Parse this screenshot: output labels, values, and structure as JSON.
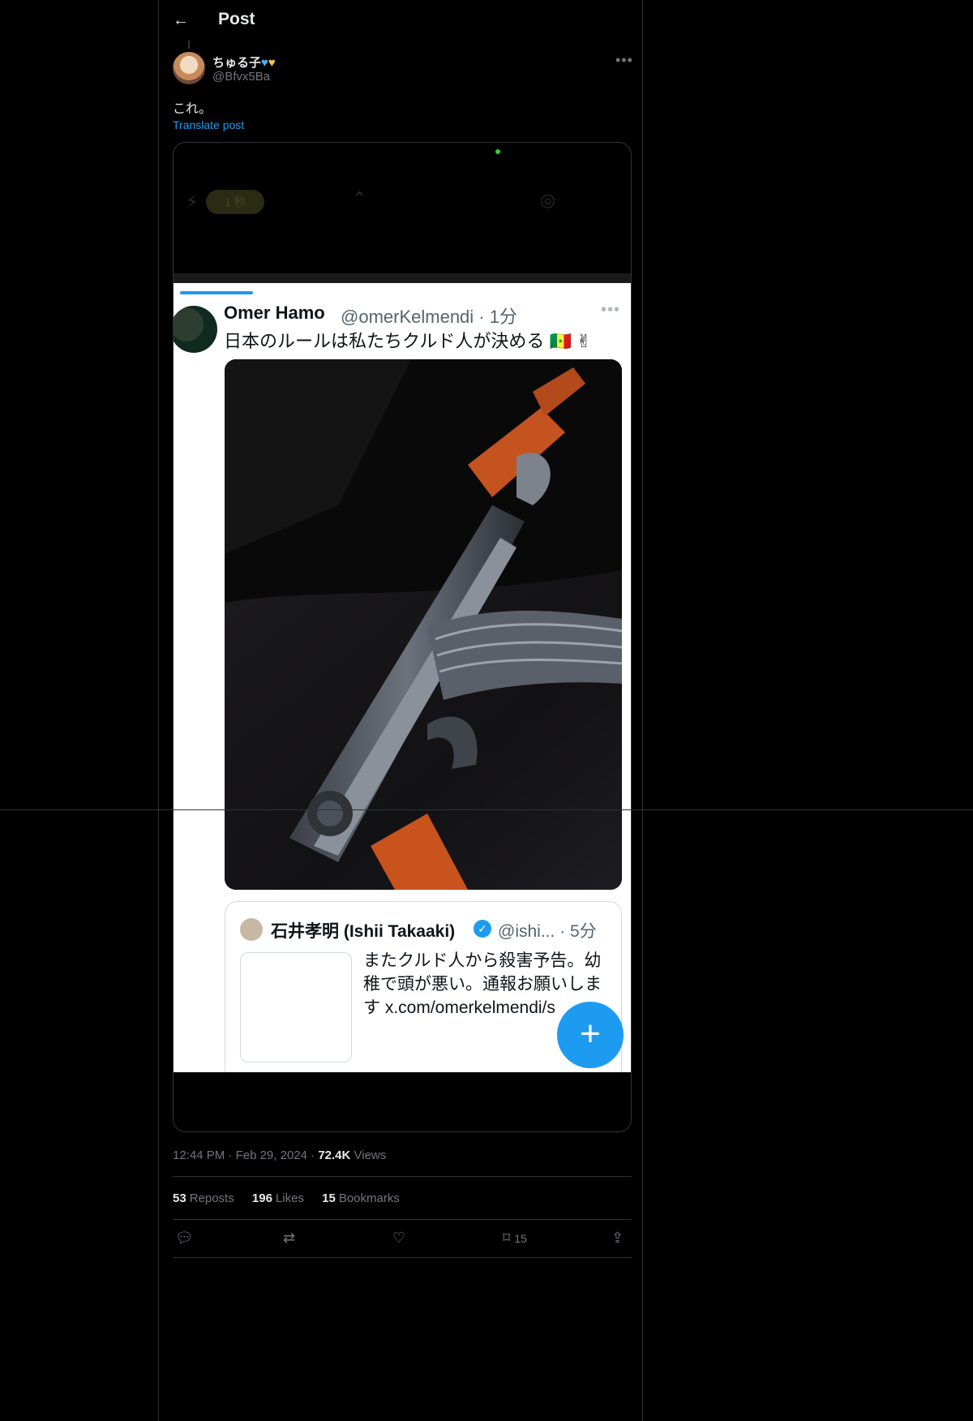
{
  "header": {
    "title": "Post"
  },
  "author": {
    "display_name": "ちゅる子",
    "handle": "@Bfvx5Ba"
  },
  "post": {
    "text": "これ。",
    "translate_label": "Translate post"
  },
  "media": {
    "camera_timer": "1 秒",
    "inner_post": {
      "name": "Omer Hamo",
      "handle": "@omerKelmendi · 1分",
      "text": "日本のルールは私たちクルド人が決める 🇸🇳 ✌",
      "quote": {
        "name": "石井孝明 (Ishii Takaaki)",
        "handle": "@ishi... · 5分",
        "text": "またクルド人から殺害予告。幼稚で頭が悪い。通報お願いします x.com/omerkelmendi/s"
      }
    }
  },
  "meta": {
    "time": "12:44 PM",
    "date": "Feb 29, 2024",
    "views_count": "72.4K",
    "views_label": "Views"
  },
  "stats": {
    "reposts_count": "53",
    "reposts_label": "Reposts",
    "likes_count": "196",
    "likes_label": "Likes",
    "bookmarks_count": "15",
    "bookmarks_label": "Bookmarks"
  },
  "actions": {
    "bookmark_count": "15"
  },
  "colors": {
    "accent": "#1d9bf0",
    "background": "#000000",
    "muted": "#71767b"
  }
}
